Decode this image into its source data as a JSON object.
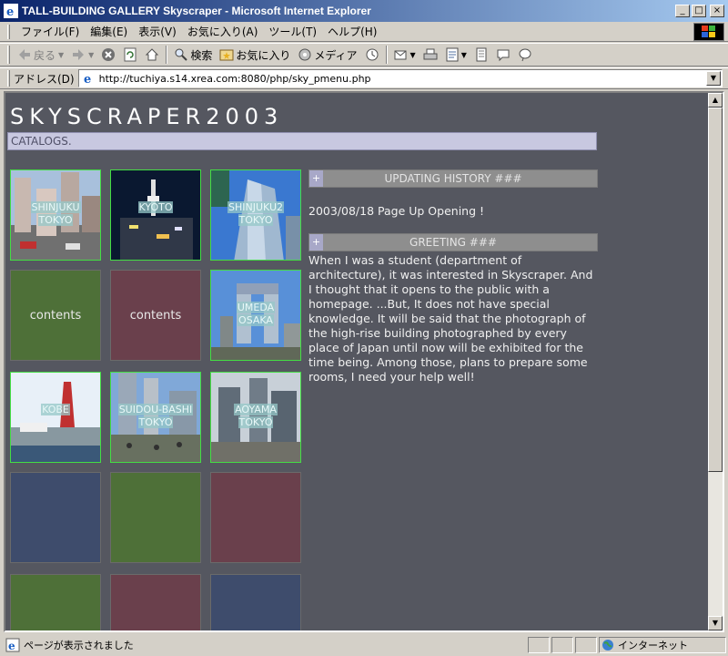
{
  "window": {
    "title": "TALL-BUILDING GALLERY Skyscraper - Microsoft Internet Explorer",
    "minimize": "_",
    "maximize": "□",
    "close": "×"
  },
  "menu": [
    "ファイル(F)",
    "編集(E)",
    "表示(V)",
    "お気に入り(A)",
    "ツール(T)",
    "ヘルプ(H)"
  ],
  "toolbar": {
    "back_label": "戻る",
    "search_label": "検索",
    "favorites_label": "お気に入り",
    "media_label": "メディア"
  },
  "address": {
    "label": "アドレス(D)",
    "url": "http://tuchiya.s14.xrea.com:8080/php/sky_pmenu.php"
  },
  "page": {
    "site_title": "SKYSCRAPER2003",
    "catalog_label": "CATALOGS.",
    "tiles": [
      {
        "caption1": "SHINJUKU",
        "caption2": "TOKYO"
      },
      {
        "caption1": "KYOTO",
        "caption2": ""
      },
      {
        "caption1": "SHINJUKU2",
        "caption2": "TOKYO"
      },
      {
        "content": "contents"
      },
      {
        "content": "contents"
      },
      {
        "caption1": "UMEDA",
        "caption2": "OSAKA"
      },
      {
        "caption1": "KOBE",
        "caption2": ""
      },
      {
        "caption1": "SUIDOU-BASHI",
        "caption2": "TOKYO"
      },
      {
        "caption1": "AOYAMA",
        "caption2": "TOKYO"
      }
    ],
    "updating_history": {
      "plus": "+",
      "heading": "UPDATING HISTORY ###",
      "entry": "2003/08/18 Page Up Opening !"
    },
    "greeting": {
      "plus": "+",
      "heading": "GREETING ###",
      "text": "When I was a student (department of architecture), it was interested in Skyscraper. And I thought that it opens to the public with a homepage. ...But, It does not have special knowledge. It will be said that the photograph of the high-rise building photographed by every place of Japan until now will be exhibited for the time being. Among those, plans to prepare some rooms, I need your help well!"
    }
  },
  "status": {
    "text": "ページが表示されました",
    "zone": "インターネット"
  },
  "colors": {
    "page_bg": "#555760",
    "tile_green": "#4e7038",
    "tile_maroon": "#6a404c",
    "tile_blue": "#3e4c6c",
    "tile_border": "#44dd44"
  }
}
